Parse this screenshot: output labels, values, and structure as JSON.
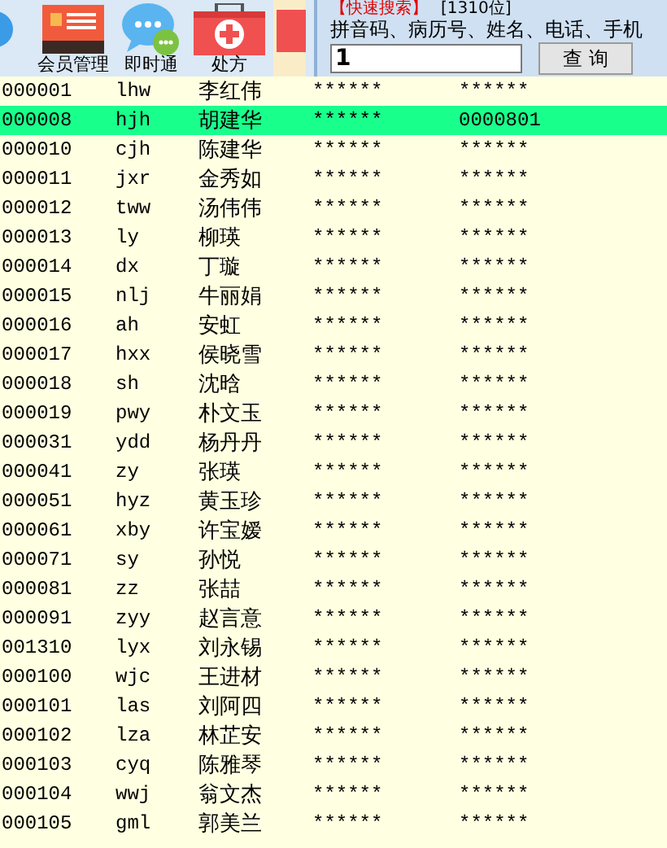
{
  "toolbar": [
    {
      "label": "会员管理",
      "kind": "card"
    },
    {
      "label": "即时通",
      "kind": "chat"
    },
    {
      "label": "处方",
      "kind": "kit"
    }
  ],
  "quick_search": {
    "title": "【快速搜索】",
    "count": "[1310位]",
    "hint": "拼音码、病历号、姓名、电话、手机",
    "value": "1",
    "button": "查 询"
  },
  "rows": [
    {
      "cells": [
        "000001",
        "lhw",
        "李红伟",
        "******",
        "******"
      ],
      "selected": false
    },
    {
      "cells": [
        "000008",
        "hjh",
        "胡建华",
        "******",
        "0000801"
      ],
      "selected": true
    },
    {
      "cells": [
        "000010",
        "cjh",
        "陈建华",
        "******",
        "******"
      ],
      "selected": false
    },
    {
      "cells": [
        "000011",
        "jxr",
        "金秀如",
        "******",
        "******"
      ],
      "selected": false
    },
    {
      "cells": [
        "000012",
        "tww",
        "汤伟伟",
        "******",
        "******"
      ],
      "selected": false
    },
    {
      "cells": [
        "000013",
        "ly",
        "柳瑛",
        "******",
        "******"
      ],
      "selected": false
    },
    {
      "cells": [
        "000014",
        "dx",
        "丁璇",
        "******",
        "******"
      ],
      "selected": false
    },
    {
      "cells": [
        "000015",
        "nlj",
        "牛丽娟",
        "******",
        "******"
      ],
      "selected": false
    },
    {
      "cells": [
        "000016",
        "ah",
        "安虹",
        "******",
        "******"
      ],
      "selected": false
    },
    {
      "cells": [
        "000017",
        "hxx",
        "侯晓雪",
        "******",
        "******"
      ],
      "selected": false
    },
    {
      "cells": [
        "000018",
        "sh",
        "沈晗",
        "******",
        "******"
      ],
      "selected": false
    },
    {
      "cells": [
        "000019",
        "pwy",
        "朴文玉",
        "******",
        "******"
      ],
      "selected": false
    },
    {
      "cells": [
        "000031",
        "ydd",
        "杨丹丹",
        "******",
        "******"
      ],
      "selected": false
    },
    {
      "cells": [
        "000041",
        "zy",
        "张瑛",
        "******",
        "******"
      ],
      "selected": false
    },
    {
      "cells": [
        "000051",
        "hyz",
        "黄玉珍",
        "******",
        "******"
      ],
      "selected": false
    },
    {
      "cells": [
        "000061",
        "xby",
        "许宝嫒",
        "******",
        "******"
      ],
      "selected": false
    },
    {
      "cells": [
        "000071",
        "sy",
        "孙悦",
        "******",
        "******"
      ],
      "selected": false
    },
    {
      "cells": [
        "000081",
        "zz",
        "张喆",
        "******",
        "******"
      ],
      "selected": false
    },
    {
      "cells": [
        "000091",
        "zyy",
        "赵言意",
        "******",
        "******"
      ],
      "selected": false
    },
    {
      "cells": [
        "001310",
        "lyx",
        "刘永锡",
        "******",
        "******"
      ],
      "selected": false
    },
    {
      "cells": [
        "000100",
        "wjc",
        "王进材",
        "******",
        "******"
      ],
      "selected": false
    },
    {
      "cells": [
        "000101",
        "las",
        "刘阿四",
        "******",
        "******"
      ],
      "selected": false
    },
    {
      "cells": [
        "000102",
        "lza",
        "林芷安",
        "******",
        "******"
      ],
      "selected": false
    },
    {
      "cells": [
        "000103",
        "cyq",
        "陈雅琴",
        "******",
        "******"
      ],
      "selected": false
    },
    {
      "cells": [
        "000104",
        "wwj",
        "翁文杰",
        "******",
        "******"
      ],
      "selected": false
    },
    {
      "cells": [
        "000105",
        "gml",
        "郭美兰",
        "******",
        "******"
      ],
      "selected": false
    }
  ]
}
